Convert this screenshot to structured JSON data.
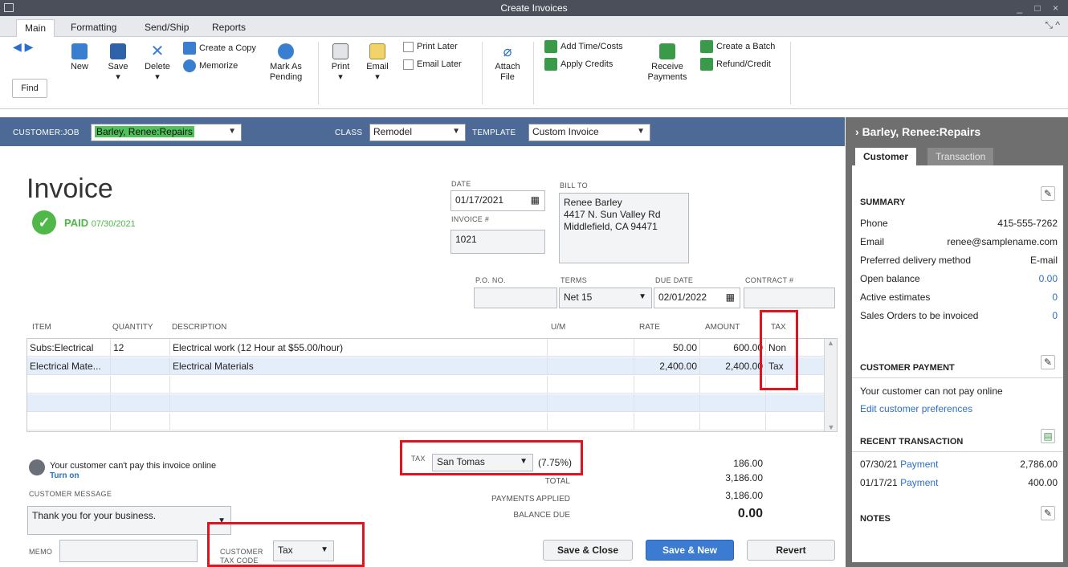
{
  "window": {
    "title": "Create Invoices",
    "controls": "_ □ ×"
  },
  "tabs": [
    "Main",
    "Formatting",
    "Send/Ship",
    "Reports"
  ],
  "window_resize_glyph": "⤡ ^",
  "ribbon": {
    "find": "Find",
    "new": "New",
    "save": "Save",
    "delete": "Delete",
    "create_copy": "Create a Copy",
    "memorize": "Memorize",
    "mark_as_pending": [
      "Mark As",
      "Pending"
    ],
    "print": "Print",
    "email": "Email",
    "print_later": "Print Later",
    "email_later": "Email Later",
    "attach_file": [
      "Attach",
      "File"
    ],
    "add_time_costs": "Add Time/Costs",
    "apply_credits": "Apply Credits",
    "receive_payments": [
      "Receive",
      "Payments"
    ],
    "create_batch": "Create a Batch",
    "refund_credit": "Refund/Credit",
    "dropdown_glyph": "▾"
  },
  "custbar": {
    "customer_job_label": "CUSTOMER:JOB",
    "customer_job_value": "Barley, Renee:Repairs",
    "class_label": "CLASS",
    "class_value": "Remodel",
    "template_label": "TEMPLATE",
    "template_value": "Custom Invoice",
    "arrow": "▼"
  },
  "invoice": {
    "title": "Invoice",
    "paid_label": "PAID",
    "paid_date": "07/30/2021",
    "date_label": "DATE",
    "date": "01/17/2021",
    "invoice_no_label": "INVOICE #",
    "invoice_no": "1021",
    "bill_to_label": "BILL TO",
    "bill_to_lines": [
      "Renee Barley",
      "4417 N. Sun Valley Rd",
      "Middlefield, CA 94471"
    ],
    "po_label": "P.O. NO.",
    "terms_label": "TERMS",
    "terms": "Net 15",
    "due_date_label": "DUE DATE",
    "due_date": "02/01/2022",
    "contract_label": "CONTRACT #",
    "calendar_glyph": "▦"
  },
  "grid": {
    "headers": [
      "ITEM",
      "QUANTITY",
      "DESCRIPTION",
      "U/M",
      "RATE",
      "AMOUNT",
      "TAX"
    ],
    "rows": [
      {
        "item": "Subs:Electrical",
        "qty": "12",
        "desc": "Electrical work (12 Hour at $55.00/hour)",
        "um": "",
        "rate": "50.00",
        "amount": "600.00",
        "tax": "Non"
      },
      {
        "item": "Electrical Mate...",
        "qty": "",
        "desc": "Electrical Materials",
        "um": "",
        "rate": "2,400.00",
        "amount": "2,400.00",
        "tax": "Tax"
      },
      {
        "item": "",
        "qty": "",
        "desc": "",
        "um": "",
        "rate": "",
        "amount": "",
        "tax": ""
      },
      {
        "item": "",
        "qty": "",
        "desc": "",
        "um": "",
        "rate": "",
        "amount": "",
        "tax": ""
      },
      {
        "item": "",
        "qty": "",
        "desc": "",
        "um": "",
        "rate": "",
        "amount": "",
        "tax": ""
      }
    ]
  },
  "bottom": {
    "online_msg": "Your customer can't pay this invoice online",
    "turn_on": "Turn on",
    "customer_message_label": "CUSTOMER MESSAGE",
    "customer_message": "Thank you for your business.",
    "memo_label": "MEMO",
    "customer_tax_code_label": [
      "CUSTOMER",
      "TAX CODE"
    ],
    "customer_tax_code": "Tax",
    "tax_label": "TAX",
    "tax_item": "San Tomas",
    "tax_rate": "(7.75%)",
    "tax_amount": "186.00",
    "total_label": "TOTAL",
    "total": "3,186.00",
    "payments_applied_label": "PAYMENTS APPLIED",
    "payments_applied": "3,186.00",
    "balance_due_label": "BALANCE DUE",
    "balance_due": "0.00",
    "save_close": "Save & Close",
    "save_new": "Save & New",
    "revert": "Revert"
  },
  "panel": {
    "title": "Barley, Renee:Repairs",
    "tabs": [
      "Customer",
      "Transaction"
    ],
    "summary_label": "SUMMARY",
    "phone_label": "Phone",
    "phone": "415-555-7262",
    "email_label": "Email",
    "email": "renee@samplename.com",
    "delivery_label": "Preferred delivery method",
    "delivery": "E-mail",
    "open_balance_label": "Open balance",
    "open_balance": "0.00",
    "active_estimates_label": "Active estimates",
    "active_estimates": "0",
    "sales_orders_label": "Sales Orders to be invoiced",
    "sales_orders": "0",
    "customer_payment_label": "CUSTOMER PAYMENT",
    "cannot_pay": "Your customer can not pay online",
    "edit_prefs": "Edit customer preferences",
    "recent_label": "RECENT TRANSACTION",
    "transactions": [
      {
        "date": "07/30/21",
        "type": "Payment",
        "amount": "2,786.00"
      },
      {
        "date": "01/17/21",
        "type": "Payment",
        "amount": "400.00"
      }
    ],
    "notes_label": "NOTES",
    "chevron": "›",
    "pencil": "✎",
    "report_glyph": "▤"
  }
}
